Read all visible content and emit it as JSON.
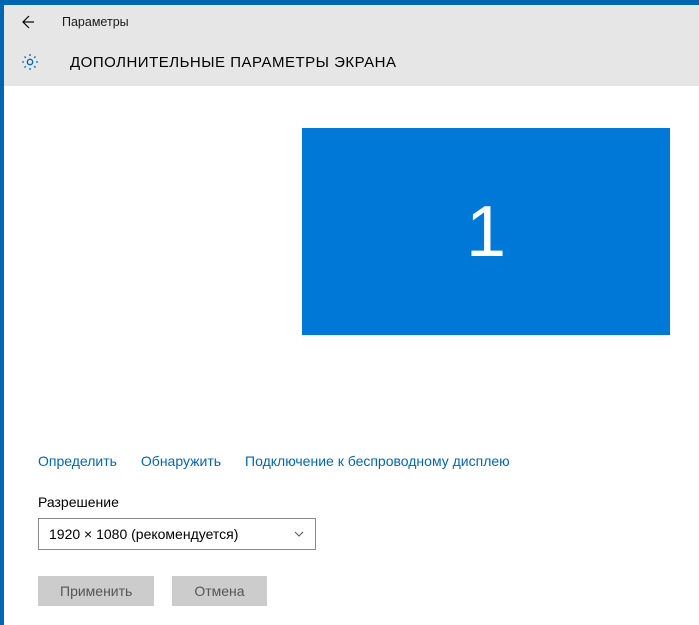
{
  "titlebar": {
    "title": "Параметры"
  },
  "subheader": {
    "title": "ДОПОЛНИТЕЛЬНЫЕ ПАРАМЕТРЫ ЭКРАНА"
  },
  "monitor": {
    "number": "1"
  },
  "links": {
    "identify": "Определить",
    "detect": "Обнаружить",
    "wireless": "Подключение к беспроводному дисплею"
  },
  "resolution": {
    "label": "Разрешение",
    "value": "1920 × 1080 (рекомендуется)"
  },
  "buttons": {
    "apply": "Применить",
    "cancel": "Отмена"
  }
}
